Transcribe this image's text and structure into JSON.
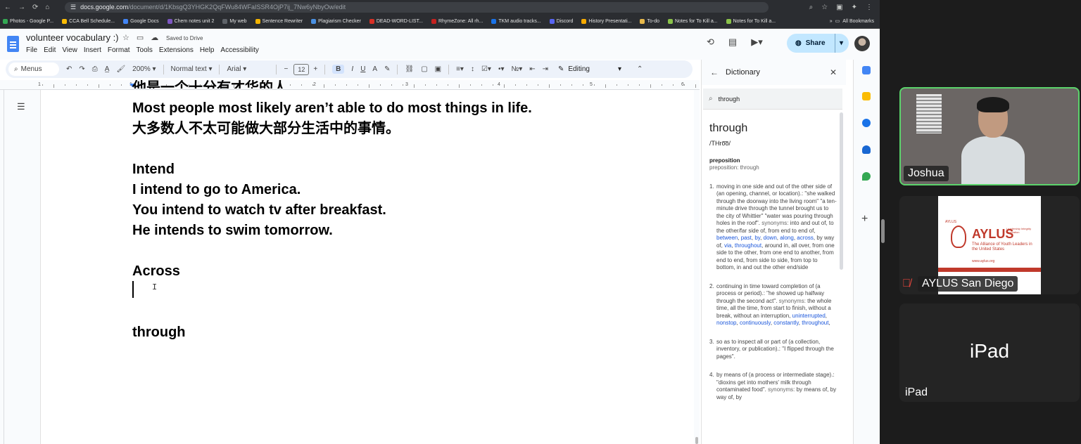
{
  "browser": {
    "url_host": "docs.google.com",
    "url_path": "/document/d/1KbsgQ3YHGK2QqFWu84WFaISSR4OjP7ij_7Nw6yNbyOw/edit",
    "bookmarks": [
      {
        "label": "Photos - Google P...",
        "color": "#34a853"
      },
      {
        "label": "CCA Bell Schedule...",
        "color": "#fbbc04"
      },
      {
        "label": "Google Docs",
        "color": "#4285f4"
      },
      {
        "label": "Chem notes unit 2",
        "color": "#7e57c2"
      },
      {
        "label": "My web",
        "color": "#5f6368"
      },
      {
        "label": "Sentence Rewriter",
        "color": "#f4b400"
      },
      {
        "label": "Plagiarism Checker",
        "color": "#4a90e2"
      },
      {
        "label": "DEAD-WORD-LIST...",
        "color": "#d93025"
      },
      {
        "label": "RhymeZone: All rh...",
        "color": "#c5221f"
      },
      {
        "label": "TKM audio tracks...",
        "color": "#1a73e8"
      },
      {
        "label": "Discord",
        "color": "#5865f2"
      },
      {
        "label": "History Presentati...",
        "color": "#f9ab00"
      },
      {
        "label": "To-do",
        "color": "#e8b84a"
      },
      {
        "label": "Notes for To Kill a...",
        "color": "#8bc34a"
      },
      {
        "label": "Notes for To Kill a...",
        "color": "#8bc34a"
      }
    ],
    "all_bookmarks": "All Bookmarks"
  },
  "docs": {
    "title": "volunteer vocabulary :)",
    "saved": "Saved to Drive",
    "menu": [
      "File",
      "Edit",
      "View",
      "Insert",
      "Format",
      "Tools",
      "Extensions",
      "Help",
      "Accessibility"
    ],
    "share": "Share",
    "toolbar": {
      "menus": "Menus",
      "zoom": "200%",
      "style": "Normal text",
      "font": "Arial",
      "size": "12",
      "mode": "Editing"
    },
    "ruler": [
      "1",
      "1",
      "2",
      "3",
      "4",
      "5",
      "6"
    ],
    "clipped_line": "他是一个十分有才华的人。",
    "lines": [
      "Most people most likely aren’t able to do most things in life.",
      "大多数人不太可能做大部分生活中的事情。",
      "",
      "Intend",
      "I intend to go to America.",
      "You intend to watch tv after breakfast.",
      "He intends to swim tomorrow.",
      "",
      "Across",
      "",
      "",
      "through"
    ]
  },
  "dictionary": {
    "title": "Dictionary",
    "query": "through",
    "word": "through",
    "pron": "/THro͞o/",
    "pos": "preposition",
    "pos_sub": "preposition: through",
    "defs": [
      {
        "num": "1.",
        "text": "moving in one side and out of the other side of (an opening, channel, or location).: \"she walked through the doorway into the living room\" \"a ten-minute drive through the tunnel brought us to the city of Whittier\" \"water was pouring through holes in the roof\".",
        "syn_label": "synonyms:",
        "syn_pre": "into and out of, to the other/far side of, from end to end of,",
        "links": [
          "between",
          "past",
          "by",
          "down",
          "along",
          "across"
        ],
        "syn_mid": "by way of,",
        "links2": [
          "via",
          "throughout"
        ],
        "syn_post": "around in, all over, from one side to the other, from one end to another, from end to end, from side to side, from top to bottom, in and out the other end/side"
      },
      {
        "num": "2.",
        "text": "continuing in time toward completion of (a process or period).: \"he showed up halfway through the second act\".",
        "syn_label": "synonyms:",
        "syn_pre": "the whole time, all the time, from start to finish, without a break, without an interruption,",
        "links": [
          "uninterrupted",
          "nonstop",
          "continuously",
          "constantly",
          "throughout"
        ]
      },
      {
        "num": "3.",
        "text": "so as to inspect all or part of (a collection, inventory, or publication).: \"I flipped through the pages\"."
      },
      {
        "num": "4.",
        "text": "by means of (a process or intermediate stage).: \"dioxins get into mothers' milk through contaminated food\".",
        "syn_label": "synonyms:",
        "syn_pre": "by means of, by way of, by"
      }
    ]
  },
  "zoom": {
    "participants": [
      {
        "name": "Joshua",
        "active": true
      },
      {
        "name": "AYLUS San Diego",
        "muted": true
      },
      {
        "name": "iPad"
      }
    ],
    "ipad_center": "iPad",
    "aylus_logo": {
      "small": "AYLUS",
      "big": "AYLUS",
      "tagline": "Leadership Integrity Innovation",
      "line": "The Alliance of Youth Leaders in the United States",
      "url": "www.aylus.org"
    }
  }
}
